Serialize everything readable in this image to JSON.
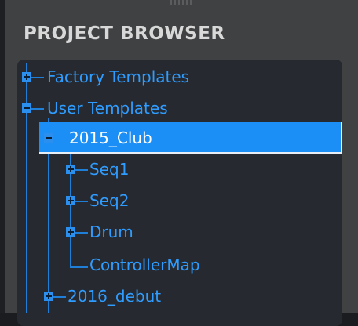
{
  "panel": {
    "title": "PROJECT BROWSER"
  },
  "tree": {
    "items": [
      {
        "label": "Factory Templates",
        "state": "collapsed"
      },
      {
        "label": "User Templates",
        "state": "expanded"
      },
      {
        "label": "2015_Club",
        "state": "expanded",
        "selected": true
      },
      {
        "label": "Seq1",
        "state": "collapsed"
      },
      {
        "label": "Seq2",
        "state": "collapsed"
      },
      {
        "label": "Drum",
        "state": "collapsed"
      },
      {
        "label": "ControllerMap",
        "state": "leaf"
      },
      {
        "label": "2016_debut",
        "state": "collapsed"
      }
    ]
  },
  "colors": {
    "accent": "#2f9cff",
    "selection": "#1b8ff5",
    "panel_bg": "#3f4143",
    "tree_bg": "#262a30"
  }
}
